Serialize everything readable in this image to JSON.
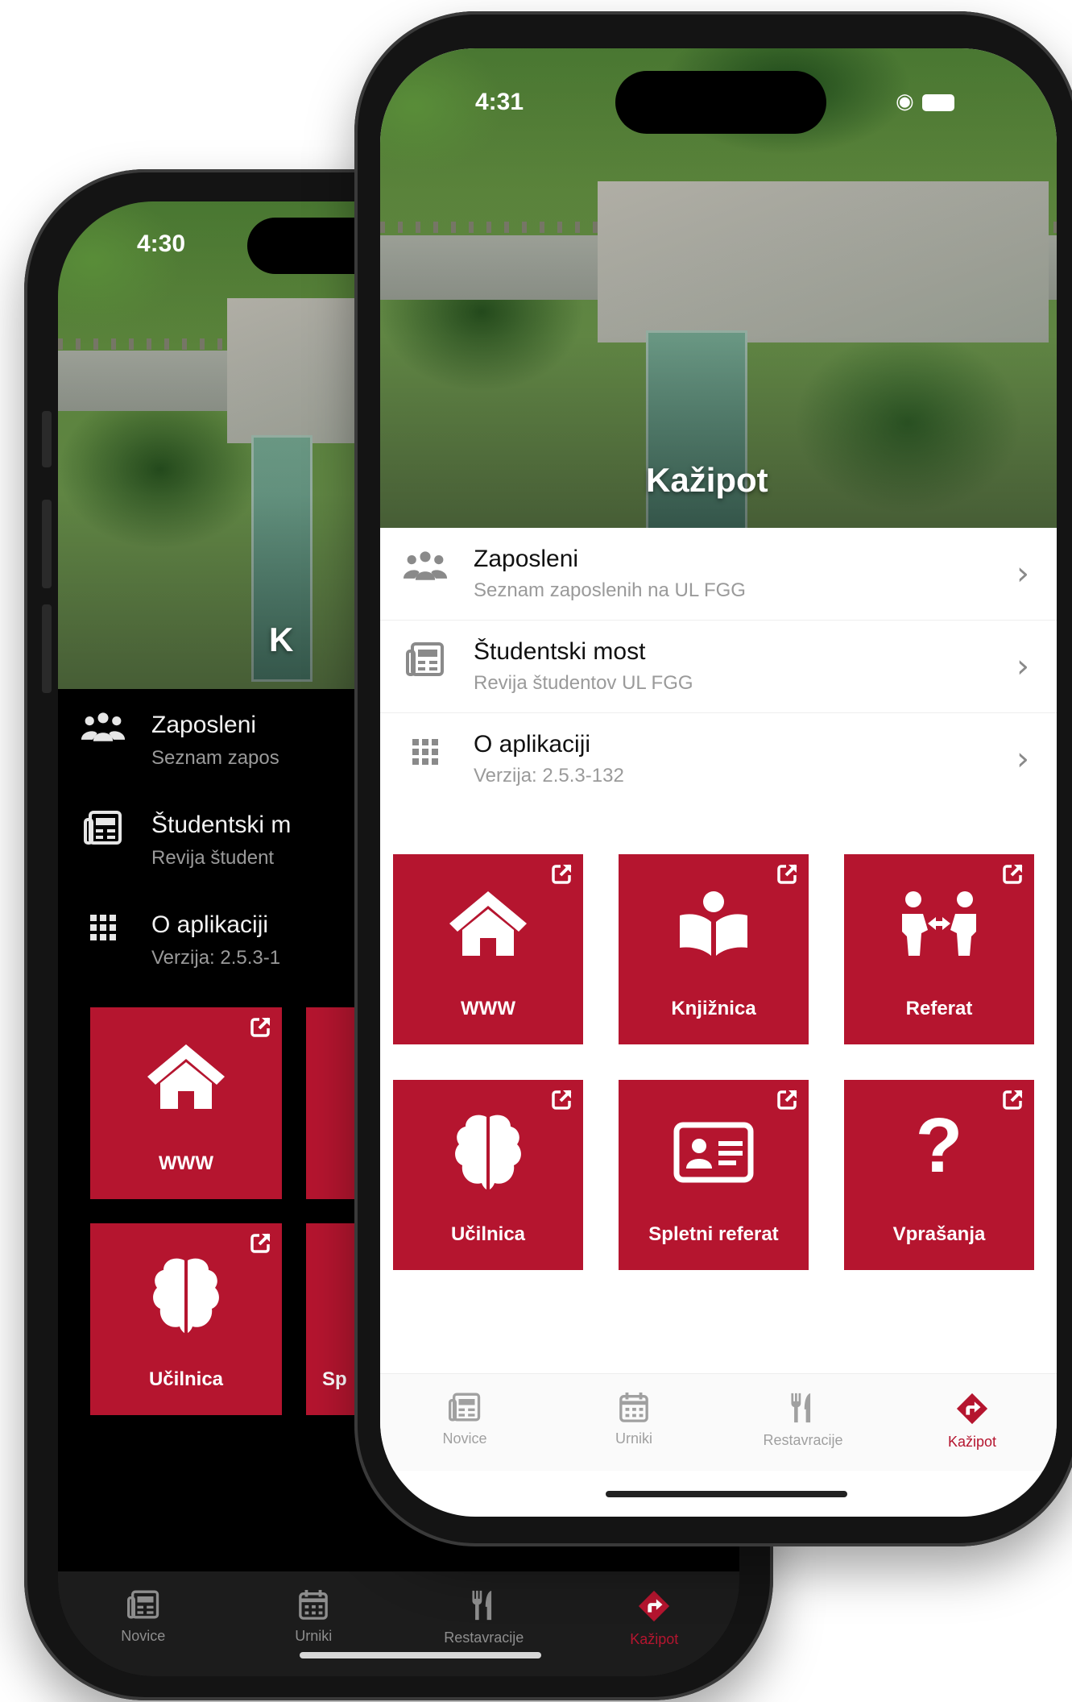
{
  "brand": {
    "accent": "#b5152f",
    "inactive_tab": "#9a9a9a"
  },
  "back_phone": {
    "status_time": "4:30",
    "hero_title_partial": "K",
    "rows": [
      {
        "title": "Zaposleni",
        "subtitle": "Seznam zapos",
        "icon": "people-icon"
      },
      {
        "title": "Študentski m",
        "subtitle": "Revija študent",
        "icon": "newspaper-icon"
      },
      {
        "title": "O aplikaciji",
        "subtitle": "Verzija: 2.5.3-1",
        "icon": "grid-dots-icon"
      }
    ],
    "tiles": [
      {
        "label": "WWW",
        "icon": "home-icon"
      },
      {
        "label": "",
        "icon": ""
      },
      {
        "label": "Učilnica",
        "icon": "brain-icon"
      },
      {
        "label": "Sp",
        "icon": ""
      }
    ],
    "tabs": [
      {
        "label": "Novice",
        "icon": "newspaper-icon",
        "active": false
      },
      {
        "label": "Urniki",
        "icon": "calendar-icon",
        "active": false
      },
      {
        "label": "Restavracije",
        "icon": "utensils-icon",
        "active": false
      },
      {
        "label": "Kažipot",
        "icon": "directions-icon",
        "active": true
      }
    ]
  },
  "front_phone": {
    "status_time": "4:31",
    "hero_title": "Kažipot",
    "rows": [
      {
        "title": "Zaposleni",
        "subtitle": "Seznam zaposlenih na UL FGG",
        "icon": "people-icon"
      },
      {
        "title": "Študentski most",
        "subtitle": "Revija študentov UL FGG",
        "icon": "newspaper-icon"
      },
      {
        "title": "O aplikaciji",
        "subtitle": "Verzija: 2.5.3-132",
        "icon": "grid-dots-icon"
      }
    ],
    "tiles": [
      {
        "label": "WWW",
        "icon": "home-icon"
      },
      {
        "label": "Knjižnica",
        "icon": "book-reader-icon"
      },
      {
        "label": "Referat",
        "icon": "people-arrows-icon"
      },
      {
        "label": "Učilnica",
        "icon": "brain-icon"
      },
      {
        "label": "Spletni referat",
        "icon": "id-card-icon"
      },
      {
        "label": "Vprašanja",
        "icon": "question-icon"
      }
    ],
    "tabs": [
      {
        "label": "Novice",
        "icon": "newspaper-icon",
        "active": false
      },
      {
        "label": "Urniki",
        "icon": "calendar-icon",
        "active": false
      },
      {
        "label": "Restavracije",
        "icon": "utensils-icon",
        "active": false
      },
      {
        "label": "Kažipot",
        "icon": "directions-icon",
        "active": true
      }
    ]
  }
}
